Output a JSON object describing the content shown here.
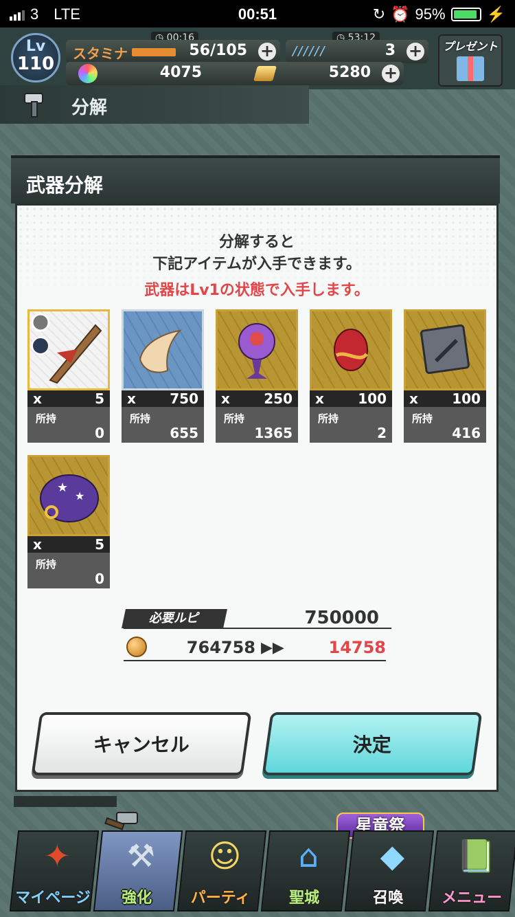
{
  "status_bar": {
    "carrier": "3",
    "network": "LTE",
    "time": "00:51",
    "battery": "95%"
  },
  "hud": {
    "level_label": "Lv",
    "level": "110",
    "stamina_label": "スタミナ",
    "stamina_timer": "00:16",
    "stamina_value": "56/105",
    "boost_timer": "53:12",
    "boost_value": "3",
    "gems": "4075",
    "gold": "5280",
    "present_label": "プレゼント"
  },
  "page_title": "分解",
  "dialog": {
    "title": "武器分解",
    "message_line1": "分解すると",
    "message_line2": "下記アイテムが入手できます。",
    "warning": "武器はLv1の状態で入手します。",
    "owned_label": "所持",
    "x_label": "x",
    "items": [
      {
        "name": "weapon",
        "qty": "5",
        "owned": "0"
      },
      {
        "name": "horn",
        "qty": "750",
        "owned": "655"
      },
      {
        "name": "eye-orb",
        "qty": "250",
        "owned": "1365"
      },
      {
        "name": "red-gem",
        "qty": "100",
        "owned": "2"
      },
      {
        "name": "sword-plate",
        "qty": "100",
        "owned": "416"
      },
      {
        "name": "star-bag",
        "qty": "5",
        "owned": "0"
      }
    ],
    "cost_label": "必要ルピ",
    "cost_value": "750000",
    "current_rupee": "764758",
    "after_rupee": "14758",
    "cancel_label": "キャンセル",
    "confirm_label": "決定"
  },
  "bottom_nav": {
    "items": [
      "マイページ",
      "強化",
      "パーティ",
      "聖城",
      "召喚",
      "メニュー"
    ],
    "festival_badge": "星竜祭"
  },
  "colors": {
    "accent_red": "#e0474b",
    "confirm": "#5fd6da",
    "gold_frame": "#c9a038"
  }
}
